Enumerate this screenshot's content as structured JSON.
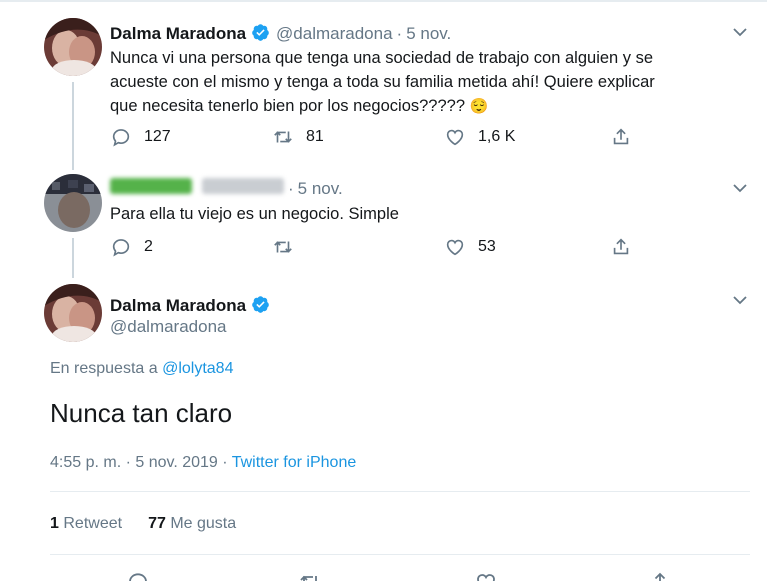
{
  "tweet1": {
    "name": "Dalma Maradona",
    "handle": "@dalmaradona",
    "time": "5 nov.",
    "text_line1": "Nunca vi una persona que tenga una sociedad de trabajo con alguien y se",
    "text_line2": "acueste con el mismo y tenga a toda su familia metida ahí! Quiere explicar",
    "text_line3": "que necesita tenerlo bien por los negocios?????",
    "emoji": "😌",
    "replies": "127",
    "retweets": "81",
    "likes": "1,6 K"
  },
  "tweet2": {
    "time": "5 nov.",
    "text": "Para ella tu viejo es un negocio. Simple",
    "replies": "2",
    "retweets": "",
    "likes": "53"
  },
  "tweet3": {
    "name": "Dalma Maradona",
    "handle": "@dalmaradona",
    "reply_prefix": "En respuesta a ",
    "reply_handle": "@lolyta84",
    "text": "Nunca tan claro",
    "timestamp": "4:55 p. m. · 5 nov. 2019 · ",
    "source": "Twitter for iPhone",
    "retweet_count": "1",
    "retweet_label": "Retweet",
    "like_count": "77",
    "like_label": "Me gusta"
  },
  "colors": {
    "accent": "#1b95e0",
    "verified": "#1da1f2",
    "secondary_text": "#657786"
  }
}
